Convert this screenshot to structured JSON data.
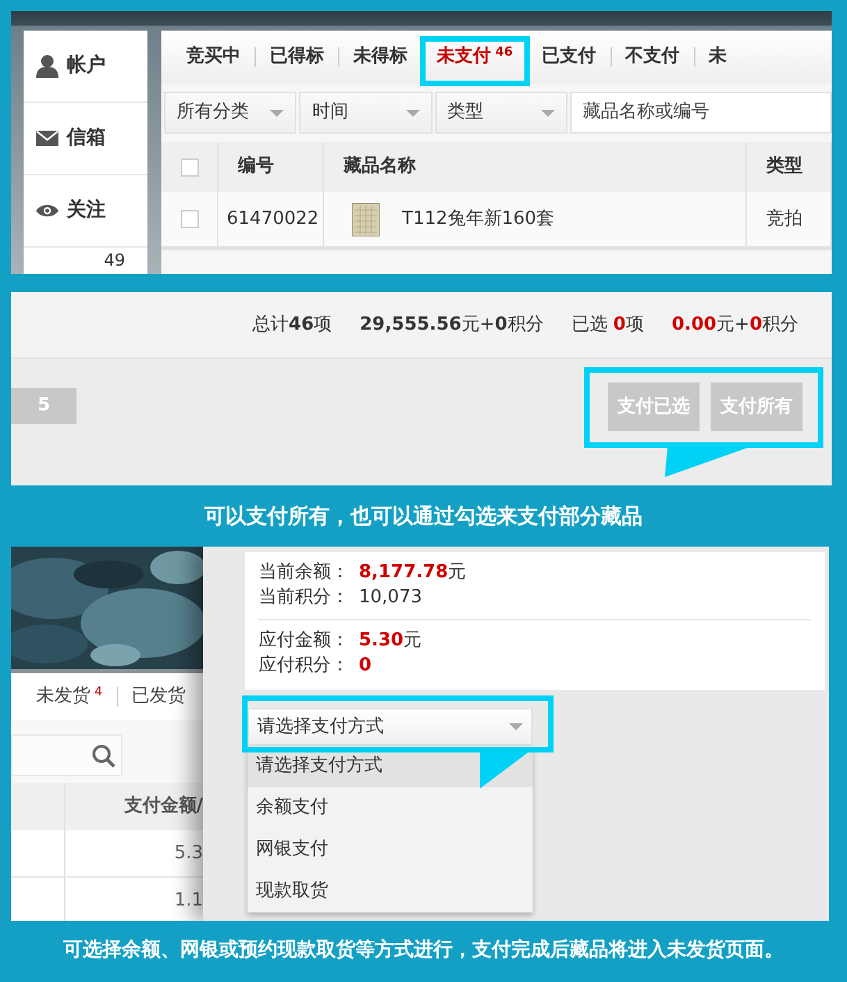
{
  "account_page": {
    "sidebar": [
      {
        "label": "帐户",
        "kind": "person"
      },
      {
        "label": "信箱",
        "kind": "mail"
      },
      {
        "label": "关注",
        "kind": "eye"
      }
    ],
    "sidebar_count": "49",
    "tabs": [
      {
        "label": "竞买中",
        "selected": false
      },
      {
        "label": "已得标",
        "selected": false
      },
      {
        "label": "未得标",
        "selected": false
      },
      {
        "label": "未支付",
        "badge": "46",
        "selected": true
      },
      {
        "label": "已支付",
        "selected": false
      },
      {
        "label": "不支付",
        "selected": false
      },
      {
        "label": "未",
        "selected": false
      }
    ],
    "filters": [
      "所有分类",
      "时间",
      "类型"
    ],
    "search": {
      "placeholder": "藏品名称或编号"
    },
    "table": {
      "select_all_checked": false,
      "columns": [
        "编号",
        "藏品名称",
        "类型"
      ],
      "rows": [
        {
          "checked": false,
          "number": "61470022",
          "name": "T112兔年新160套",
          "type": "竞拍"
        }
      ]
    }
  },
  "payment_summary": {
    "totals": [
      {
        "text": "总计**46**项",
        "highlight": false
      },
      {
        "text": "**29,555.56**元+**0**积分",
        "highlight": false
      },
      {
        "text": "已选 **0**项",
        "highlight": true
      },
      {
        "text": "**0.00**元+**0**积分",
        "highlight": true
      }
    ],
    "page_button": "5",
    "buttons": [
      "支付已选",
      "支付所有"
    ]
  },
  "caption_1": "可以支付所有，也可以通过勾选来支付部分藏品",
  "order_page": {
    "tabs": [
      {
        "label": "未发货",
        "badge": "4"
      },
      {
        "label": "已发货"
      }
    ],
    "column": "支付金额/",
    "amounts": [
      "5.3",
      "1.1"
    ]
  },
  "payment_dialog": {
    "balance_rows": [
      {
        "label": "当前余额：",
        "value": "8,177.78",
        "unit": "元",
        "highlight": true
      },
      {
        "label": "当前积分：",
        "value": "10,073",
        "highlight": false
      }
    ],
    "due_rows": [
      {
        "label": "应付金额：",
        "value": "5.30",
        "unit": "元",
        "highlight": true
      },
      {
        "label": "应付积分：",
        "value": "0",
        "highlight": true
      }
    ],
    "select": {
      "value": "请选择支付方式"
    },
    "options": [
      {
        "label": "请选择支付方式",
        "selected": true
      },
      {
        "label": "余额支付",
        "selected": false
      },
      {
        "label": "网银支付",
        "selected": false
      },
      {
        "label": "现款取货",
        "selected": false
      }
    ]
  },
  "caption_2": "可选择余额、网银或预约现款取货等方式进行，支付完成后藏品将进入未发货页面。"
}
